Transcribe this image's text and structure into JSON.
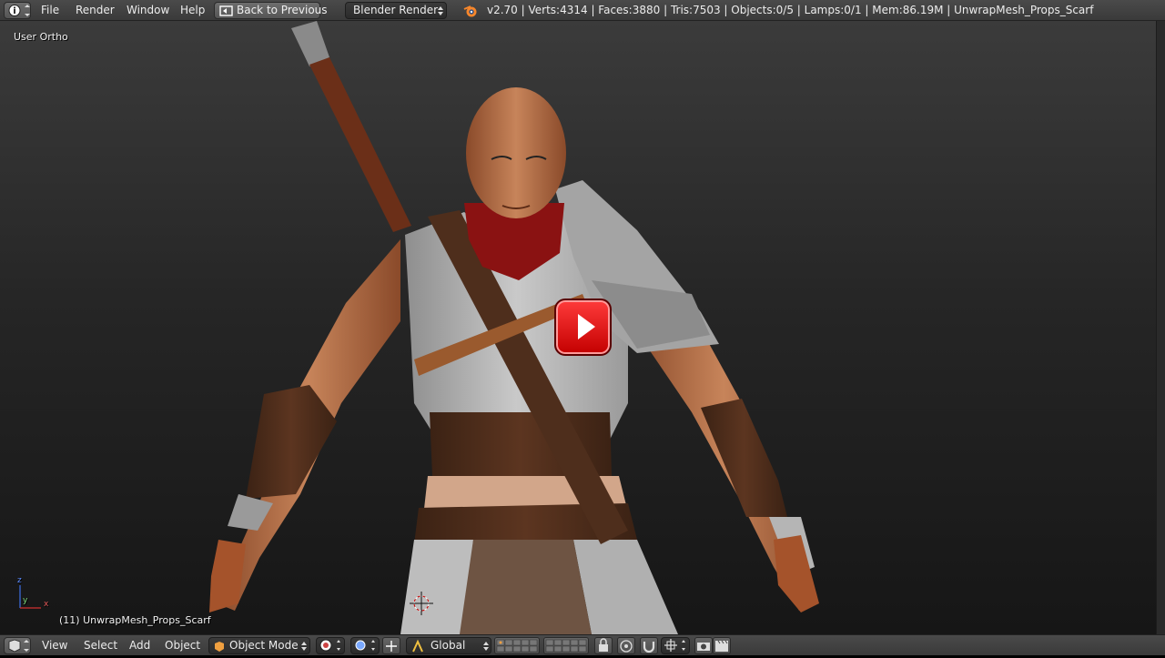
{
  "top_bar": {
    "menus": [
      "File",
      "Render",
      "Window",
      "Help"
    ],
    "back_button": "Back to Previous",
    "render_engine": "Blender Render",
    "stats": "v2.70 | Verts:4314 | Faces:3880 | Tris:7503 | Objects:0/5 | Lamps:0/1 | Mem:86.19M | UnwrapMesh_Props_Scarf"
  },
  "viewport": {
    "view_label": "User Ortho",
    "object_label": "(11) UnwrapMesh_Props_Scarf",
    "axis_z": "z",
    "axis_y": "y",
    "axis_x": "x"
  },
  "bottom_bar": {
    "menus": [
      "View",
      "Select",
      "Add",
      "Object"
    ],
    "mode": "Object Mode",
    "orientation": "Global"
  },
  "colors": {
    "header_bg": "#434343",
    "viewport_top": "#3b3b3b",
    "viewport_bottom": "#161616",
    "play_red": "#e00000",
    "blender_orange": "#f5862b"
  }
}
